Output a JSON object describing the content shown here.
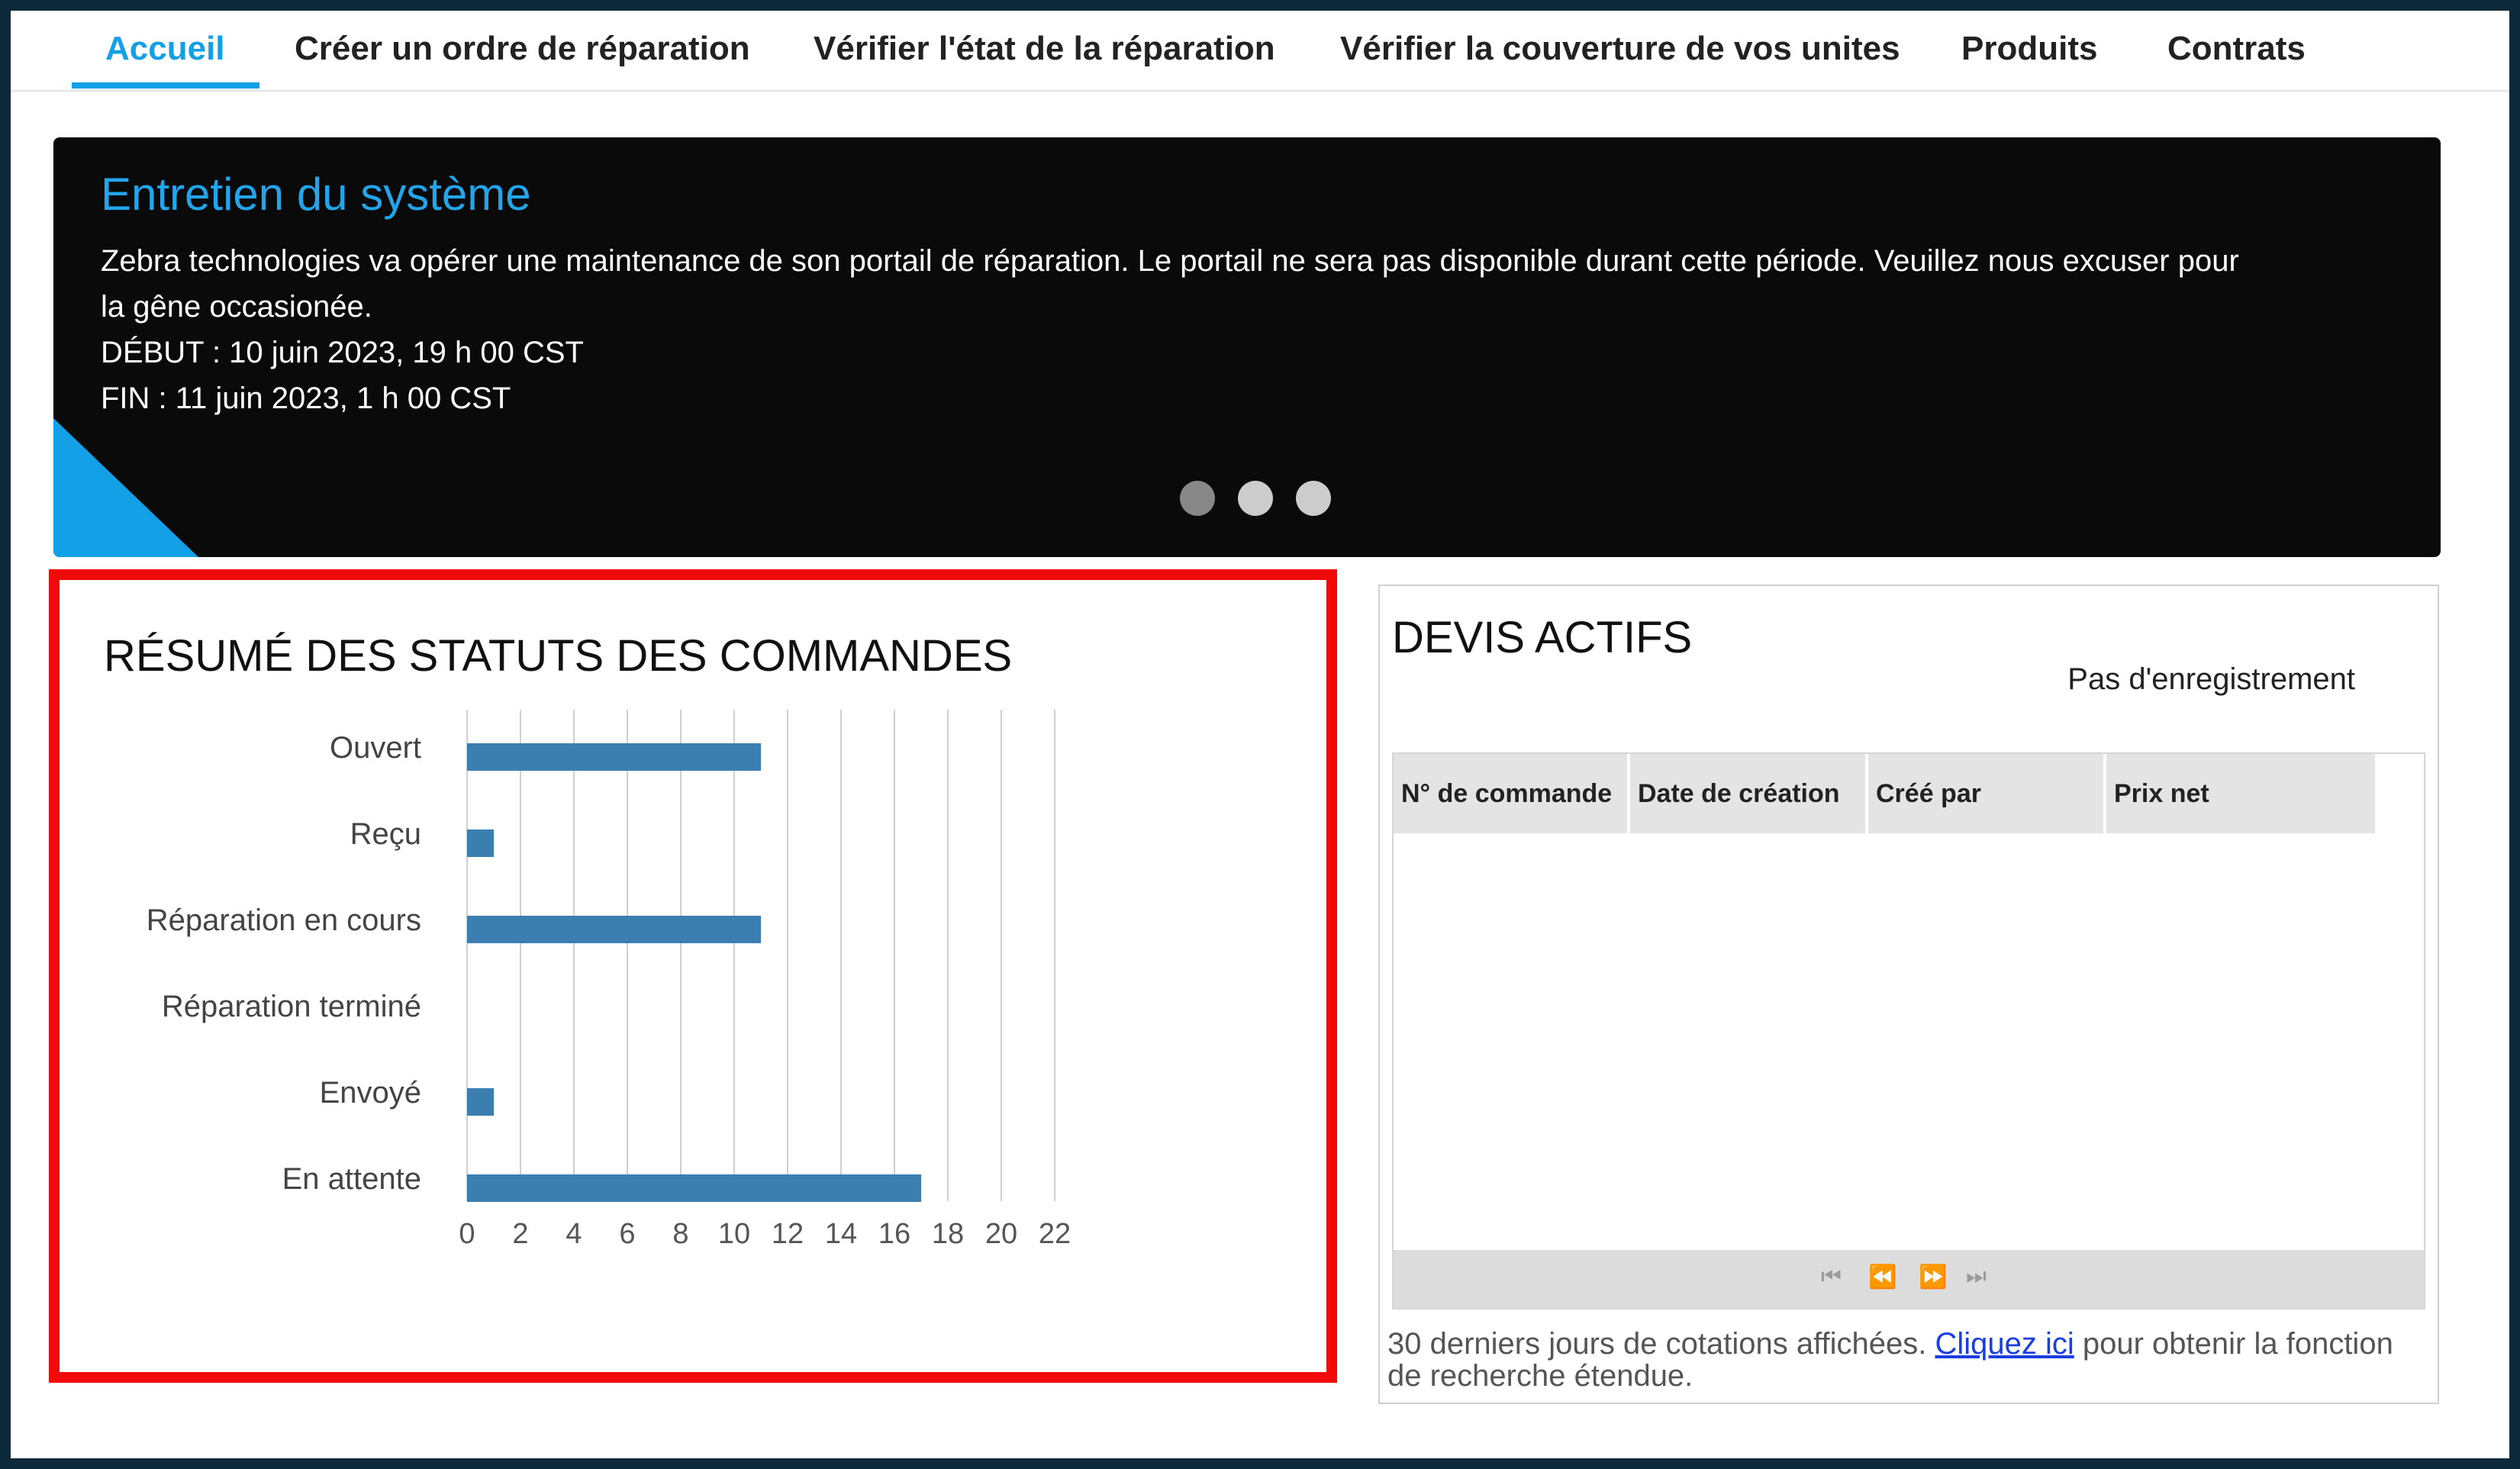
{
  "nav": {
    "tabs": [
      {
        "label": "Accueil",
        "active": true
      },
      {
        "label": "Créer un ordre de réparation",
        "active": false
      },
      {
        "label": "Vérifier l'état de la réparation",
        "active": false
      },
      {
        "label": "Vérifier la couverture de vos unites",
        "active": false
      },
      {
        "label": "Produits",
        "active": false
      },
      {
        "label": "Contrats",
        "active": false
      }
    ]
  },
  "banner": {
    "title": "Entretien du système",
    "line1": "Zebra technologies va opérer une maintenance de son portail de réparation. Le portail ne sera pas disponible durant cette période. Veuillez nous excuser pour",
    "line2": "la gêne occasionée.",
    "line3": "DÉBUT : 10 juin 2023, 19 h 00 CST",
    "line4": "FIN : 11 juin 2023, 1 h 00 CST",
    "dots": [
      {
        "color": "#888888",
        "active": true
      },
      {
        "color": "#cccccc",
        "active": false
      },
      {
        "color": "#cccccc",
        "active": false
      }
    ],
    "accent": "#14a0e6"
  },
  "left_panel": {
    "title": "RÉSUMÉ DES STATUTS DES COMMANDES",
    "highlight_color": "#f00a0a"
  },
  "chart_data": {
    "type": "bar",
    "orientation": "horizontal",
    "categories": [
      "Ouvert",
      "Reçu",
      "Réparation en cours",
      "Réparation terminé",
      "Envoyé",
      "En attente"
    ],
    "values": [
      11,
      1,
      11,
      0,
      1,
      17
    ],
    "xlim": [
      0,
      22
    ],
    "xticks": [
      0,
      2,
      4,
      6,
      8,
      10,
      12,
      14,
      16,
      18,
      20,
      22
    ],
    "grid": true,
    "bar_color": "#3a7fb0"
  },
  "right_panel": {
    "title": "DEVIS ACTIFS",
    "no_record": "Pas d'enregistrement",
    "columns": [
      "N° de commande",
      "Date de création",
      "Créé par",
      "Prix net"
    ],
    "pager_icons": [
      "first-page-icon",
      "prev-page-icon",
      "next-page-icon",
      "last-page-icon"
    ],
    "footnote_before": "30 derniers jours de cotations affichées. ",
    "footnote_link": "Cliquez ici",
    "footnote_after": " pour obtenir la fonction de recherche étendue."
  }
}
